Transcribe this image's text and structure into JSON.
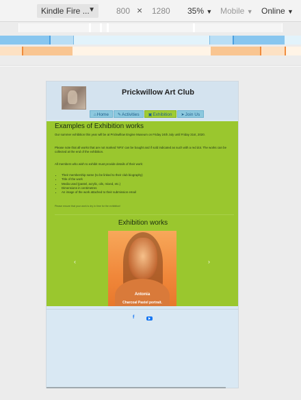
{
  "devtools": {
    "device": "Kindle Fire ...",
    "width": "800",
    "times": "×",
    "height": "1280",
    "zoom": "35%",
    "throttle": "Mobile",
    "network": "Online"
  },
  "site": {
    "title": "Prickwillow Art Club",
    "nav": [
      {
        "label": "Home",
        "icon": "home-icon"
      },
      {
        "label": "Activities",
        "icon": "pencil-icon"
      },
      {
        "label": "Exhibition",
        "icon": "image-icon"
      },
      {
        "label": "Join Us",
        "icon": "paperplane-icon"
      }
    ],
    "heading": "Examples of Exhibition works",
    "p1": "Our summer exhibition this year will be at Prickwillow Engine Museum on Friday 24th July until Friday 31st, 2020.",
    "p2": "Please note that all works that are not marked 'NFS' can be bought and if sold indicated as such with a red dot. The works can be collected at the end of the exhibition.",
    "p3": "All members who wish to exhibit must provide details of their work:",
    "list": [
      "Their membership name (to be linked to their club biography)",
      "Title of the work",
      "Media used (pastel, acrylic, oils, mixed, etc.)",
      "Dimensions in centimetres",
      "An image of the work attached to their submission email"
    ],
    "note": "Please ensure that your work is dry in time for the exhibition!",
    "gallery_heading": "Exhibition works",
    "carousel": {
      "name": "Antonia",
      "desc": "Charcoal Pastel portrait.",
      "prev": "‹",
      "next": "›"
    },
    "footer": {
      "facebook": "f"
    }
  },
  "colors": {
    "green": "#9ac72e",
    "nav_blue": "#8cc8de",
    "accent_blue": "#1877f2"
  }
}
